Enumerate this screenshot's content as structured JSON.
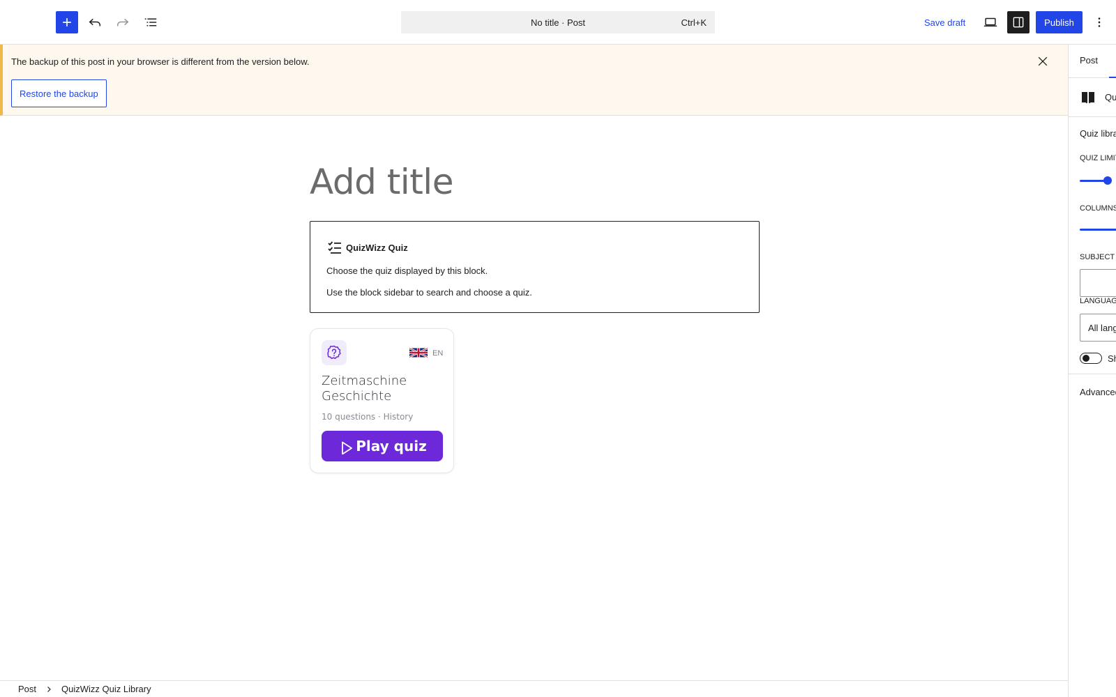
{
  "toolbar": {
    "document_title": "No title · Post",
    "shortcut": "Ctrl+K",
    "save_draft_label": "Save draft",
    "publish_label": "Publish"
  },
  "notice": {
    "message": "The backup of this post in your browser is different from the version below.",
    "restore_label": "Restore the backup"
  },
  "editor": {
    "title_placeholder": "Add title",
    "quiz_block": {
      "heading": "QuizWizz Quiz",
      "line1": "Choose the quiz displayed by this block.",
      "line2": "Use the block sidebar to search and choose a quiz."
    },
    "quiz_card": {
      "language_code": "EN",
      "title": "Zeitmaschine Geschichte",
      "meta": "10 questions · History",
      "play_label": "Play quiz"
    }
  },
  "footer": {
    "breadcrumb": [
      "Post",
      "QuizWizz Quiz Library"
    ]
  },
  "sidebar": {
    "tab_post": "Post",
    "block_name": "Qu",
    "panel_title": "Quiz libra",
    "quiz_limit_label": "QUIZ LIMIT",
    "columns_label": "COLUMNS",
    "subject_label": "SUBJECT",
    "language_label": "LANGUAG",
    "language_value": "All lang",
    "toggle_label": "Sh",
    "advanced_label": "Advanced"
  },
  "colors": {
    "accent": "#2145e6",
    "notice_border": "#f0b849",
    "notice_bg": "#fef8ee",
    "quiz_purple": "#6c28d9"
  },
  "icons": {
    "add": "plus-icon",
    "undo": "undo-icon",
    "redo": "redo-icon",
    "document_overview": "list-view-icon",
    "preview": "laptop-icon",
    "settings": "sidebar-toggle-icon",
    "options": "vertical-ellipsis-icon",
    "close": "close-icon",
    "quiz_block": "checklist-icon",
    "quiz_card": "question-badge-icon",
    "flag": "uk-flag-icon",
    "play": "play-icon",
    "breadcrumb_separator": "chevron-right-icon",
    "block_type": "book-icon"
  }
}
